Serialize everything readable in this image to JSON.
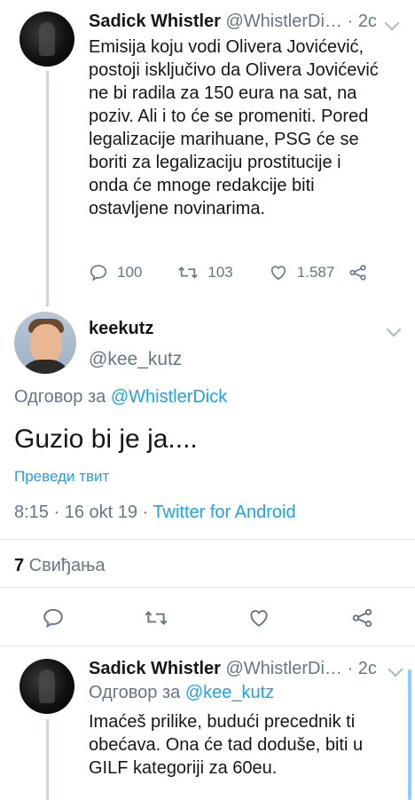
{
  "tweet1": {
    "name": "Sadick Whistler",
    "handle": "@WhistlerDi…",
    "time": "· 2c",
    "lines": [
      "Emisija koju vodi Olivera Jovićević,",
      "postoji isključivo da Olivera Jovićević",
      "ne bi radila za 150 eura na sat, na",
      "poziv. Ali i to će se promeniti. Pored",
      "legalizacije marihuane, PSG će se",
      "boriti za legalizaciju prostitucije i",
      "onda će mnoge redakcije biti",
      "ostavljene novinarima."
    ],
    "replies": "100",
    "retweets": "103",
    "likes": "1.587"
  },
  "main": {
    "name": "keekutz",
    "handle": "@kee_kutz",
    "reply_prefix": "Одговор за",
    "reply_handle": "@WhistlerDick",
    "text": "Guzio bi je ja....",
    "translate": "Преведи твит",
    "timestamp": "8:15 · 16 okt 19 · ",
    "source": "Twitter for Android",
    "likes_count": "7",
    "likes_label": " Свиђања"
  },
  "tweet3": {
    "name": "Sadick Whistler",
    "handle": "@WhistlerDi…",
    "time": "· 2c",
    "reply_prefix": "Одговор за",
    "reply_handle": "@kee_kutz",
    "lines": [
      "Imaćeš prilike, budući precednik ti",
      "obećava. Ona će tad doduše, biti u",
      "GILF kategoriji za 60eu."
    ]
  },
  "icons": {
    "reply": "reply-icon",
    "retweet": "retweet-icon",
    "like": "heart-icon",
    "share": "share-icon",
    "more": "chevron-down-icon"
  },
  "colors": {
    "link": "#1da1f2",
    "muted": "#657786",
    "text": "#14171a"
  }
}
